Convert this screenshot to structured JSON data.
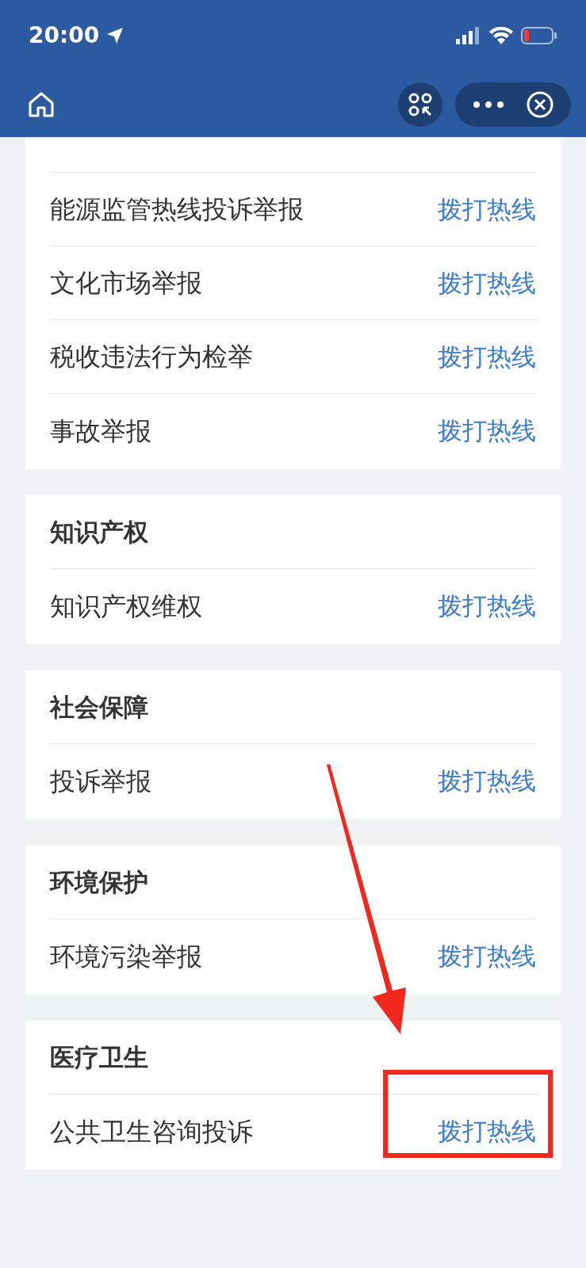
{
  "status_bar": {
    "time": "20:00"
  },
  "sections": [
    {
      "items": [
        {
          "label": "能源监管热线投诉举报",
          "action": "拨打热线"
        },
        {
          "label": "文化市场举报",
          "action": "拨打热线"
        },
        {
          "label": "税收违法行为检举",
          "action": "拨打热线"
        },
        {
          "label": "事故举报",
          "action": "拨打热线"
        }
      ]
    },
    {
      "title": "知识产权",
      "items": [
        {
          "label": "知识产权维权",
          "action": "拨打热线"
        }
      ]
    },
    {
      "title": "社会保障",
      "items": [
        {
          "label": "投诉举报",
          "action": "拨打热线"
        }
      ]
    },
    {
      "title": "环境保护",
      "items": [
        {
          "label": "环境污染举报",
          "action": "拨打热线"
        }
      ]
    },
    {
      "title": "医疗卫生",
      "items": [
        {
          "label": "公共卫生咨询投诉",
          "action": "拨打热线"
        }
      ]
    }
  ]
}
